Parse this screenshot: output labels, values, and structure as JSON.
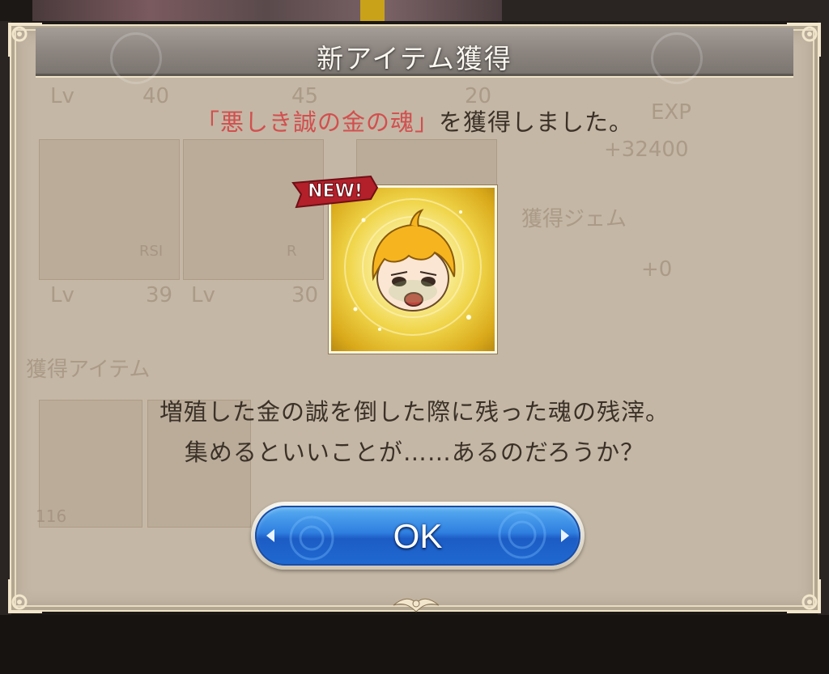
{
  "dialog": {
    "title": "新アイテム獲得",
    "message_item_name": "「悪しき誠の金の魂」",
    "message_suffix": "を獲得しました。",
    "badge": "NEW!",
    "description_line1": "増殖した金の誠を倒した際に残った魂の残滓。",
    "description_line2": "集めるといいことが……あるのだろうか？",
    "ok_label": "OK"
  },
  "background": {
    "lv_label": "Lv",
    "char1_lv": "39",
    "char2_lv": "30",
    "top_lv1": "40",
    "top_lv2": "45",
    "top_lv3": "20",
    "exp_label": "EXP",
    "exp_value": "+32400",
    "gem_label": "獲得ジェム",
    "gem_value": "+0",
    "items_label": "獲得アイテム",
    "item_count": "116",
    "char1_tag": "RSI",
    "char2_tag": "R"
  },
  "colors": {
    "accent_red": "#d24f4f",
    "button_blue": "#2f7fe0",
    "panel": "#c4b7a5",
    "text": "#3b3128"
  }
}
